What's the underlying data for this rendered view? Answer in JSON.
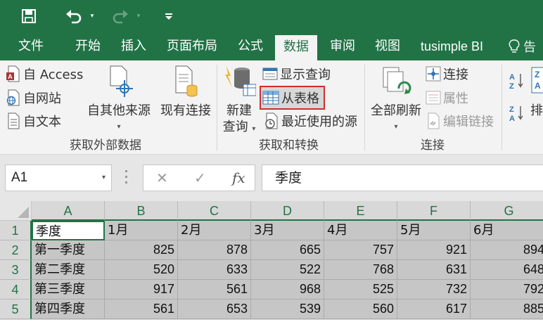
{
  "quick_access": {
    "save_icon": "save-icon",
    "undo_icon": "undo-icon",
    "redo_icon": "redo-icon",
    "customize_icon": "customize-toolbar-icon"
  },
  "tabs": [
    {
      "label": "文件"
    },
    {
      "label": "开始"
    },
    {
      "label": "插入"
    },
    {
      "label": "页面布局"
    },
    {
      "label": "公式"
    },
    {
      "label": "数据",
      "active": true
    },
    {
      "label": "审阅"
    },
    {
      "label": "视图"
    },
    {
      "label": "tusimple BI"
    }
  ],
  "tell_me": {
    "label": "告"
  },
  "ribbon": {
    "external": {
      "access": "自 Access",
      "web": "自网站",
      "text": "自文本",
      "other_line1": "自其他来源",
      "existing": "现有连接",
      "group_label": "获取外部数据"
    },
    "transform": {
      "new_query_line1": "新建",
      "new_query_line2": "查询",
      "show_queries": "显示查询",
      "from_table": "从表格",
      "recent_sources": "最近使用的源",
      "group_label": "获取和转换"
    },
    "connections": {
      "refresh_all": "全部刷新",
      "connections": "连接",
      "properties": "属性",
      "edit_links": "编辑链接",
      "group_label": "连接"
    },
    "sort": {
      "partial_label": "排"
    }
  },
  "formula_bar": {
    "name_box": "A1",
    "cancel": "✕",
    "enter": "✓",
    "fx": "fx",
    "value": "季度"
  },
  "sheet": {
    "columns": [
      "A",
      "B",
      "C",
      "D",
      "E",
      "F",
      "G"
    ],
    "rows": [
      "1",
      "2",
      "3",
      "4",
      "5"
    ],
    "cells": [
      [
        "季度",
        "1月",
        "2月",
        "3月",
        "4月",
        "5月",
        "6月"
      ],
      [
        "第一季度",
        "825",
        "878",
        "665",
        "757",
        "921",
        "894"
      ],
      [
        "第二季度",
        "520",
        "633",
        "522",
        "768",
        "631",
        "648"
      ],
      [
        "第三季度",
        "917",
        "561",
        "968",
        "525",
        "732",
        "792"
      ],
      [
        "第四季度",
        "561",
        "653",
        "539",
        "560",
        "617",
        "885"
      ]
    ]
  },
  "colors": {
    "excel_green": "#217346",
    "highlight_border": "#d12d2d",
    "selection_fill": "#c6c6c6"
  }
}
